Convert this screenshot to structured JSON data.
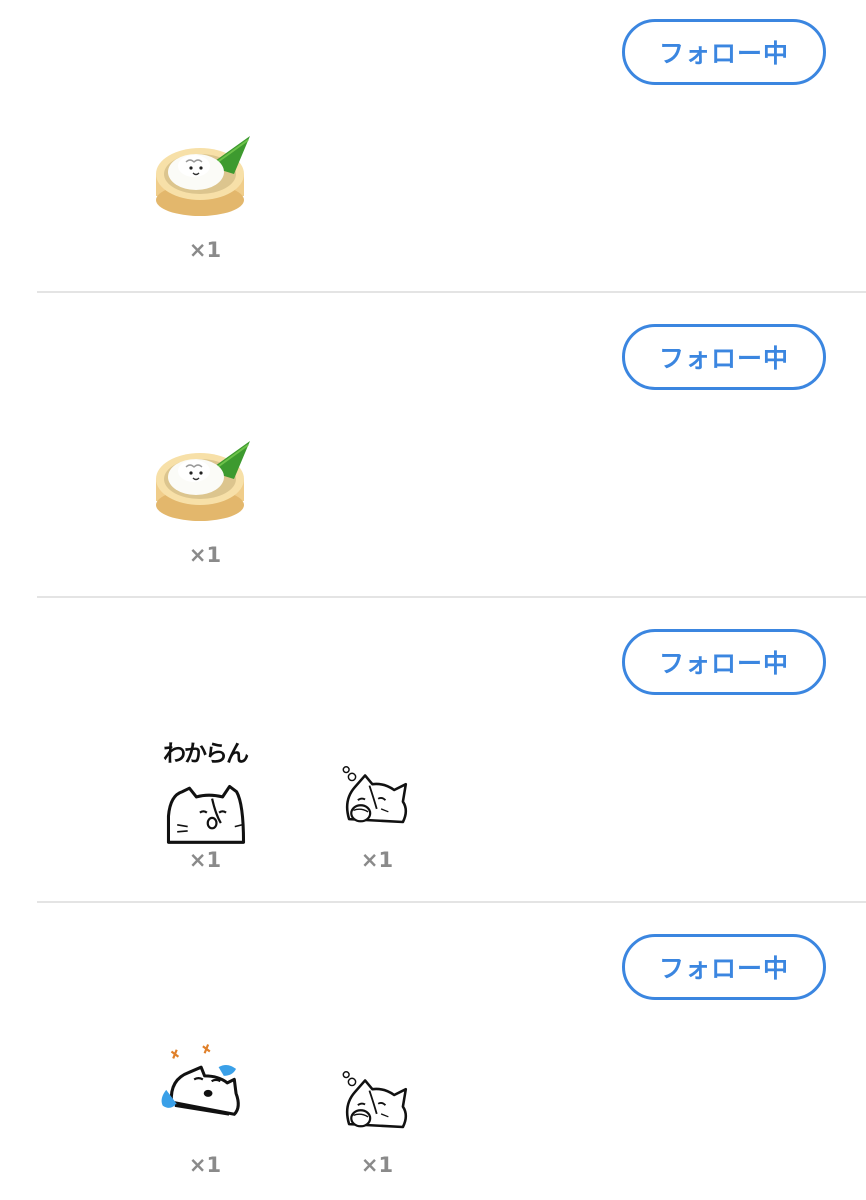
{
  "posts": [
    {
      "follow_label": "フォロー中",
      "stickers": [
        {
          "icon": "dumpling-steamer-icon",
          "count": "×1"
        }
      ]
    },
    {
      "follow_label": "フォロー中",
      "stickers": [
        {
          "icon": "dumpling-steamer-icon",
          "count": "×1"
        }
      ]
    },
    {
      "follow_label": "フォロー中",
      "stickers": [
        {
          "icon": "cat-wakaran-icon",
          "caption": "わからん",
          "count": "×1"
        },
        {
          "icon": "cat-yawning-icon",
          "count": "×1"
        }
      ]
    },
    {
      "follow_label": "フォロー中",
      "stickers": [
        {
          "icon": "cat-crying-laughing-icon",
          "count": "×1"
        },
        {
          "icon": "cat-yawning-icon",
          "count": "×1"
        }
      ]
    }
  ],
  "colors": {
    "accent": "#3b86e0",
    "count_text": "#8a8a8a",
    "divider": "#e4e4e4"
  }
}
